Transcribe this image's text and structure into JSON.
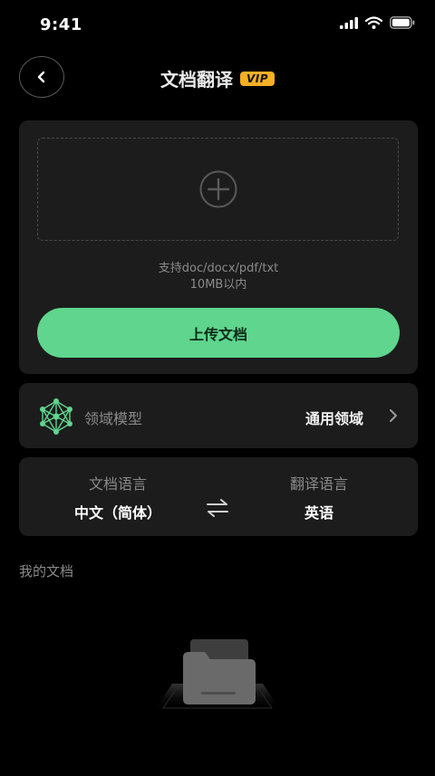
{
  "status_bar": {
    "time": "9:41",
    "icons": [
      "signal-icon",
      "wifi-icon",
      "battery-icon"
    ]
  },
  "nav": {
    "back_icon": "back-arrow-icon",
    "title": "文档翻译",
    "badge": "VIP"
  },
  "upload": {
    "add_icon": "plus-circle-icon",
    "hint_formats": "支持doc/docx/pdf/txt",
    "hint_size": "10MB以内",
    "button_label": "上传文档"
  },
  "domain": {
    "icon": "network-model-icon",
    "label": "领域模型",
    "value": "通用领域",
    "chevron": "chevron-right-icon"
  },
  "languages": {
    "source_label": "文档语言",
    "source_value": "中文（简体）",
    "swap_icon": "swap-icon",
    "target_label": "翻译语言",
    "target_value": "英语"
  },
  "my_docs": {
    "title": "我的文档",
    "empty_icon": "empty-folder-illustration"
  },
  "colors": {
    "background": "#000000",
    "card": "#1c1c1c",
    "accent": "#5fd58d",
    "vip": "#f5b025",
    "muted_text": "#8a8a8a"
  }
}
